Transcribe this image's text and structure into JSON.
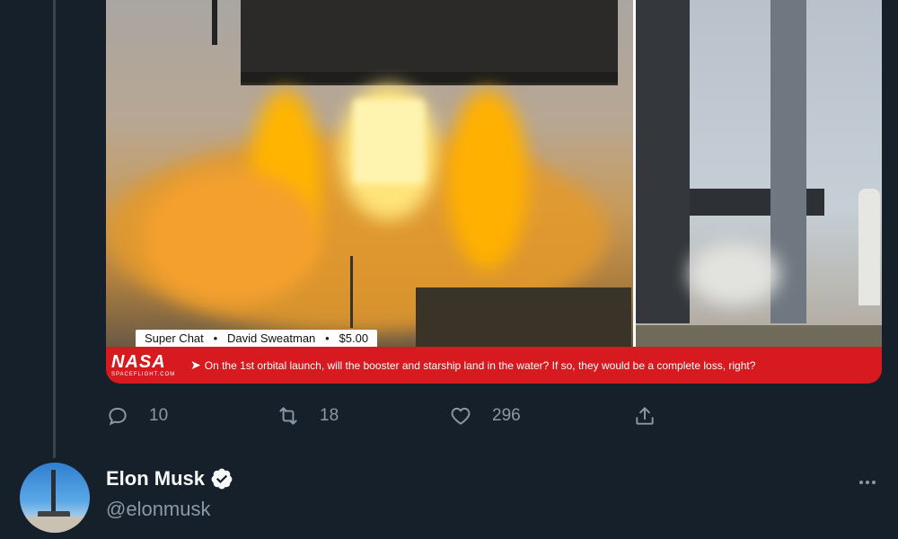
{
  "media": {
    "superchat": {
      "label": "Super Chat",
      "sep": "•",
      "name": "David Sweatman",
      "amount": "$5.00"
    },
    "banner": {
      "logo": "NASA",
      "logo_sub": "SPACEFLIGHT.COM",
      "arrow": "➤",
      "question": "On the 1st orbital launch, will the booster and starship land in the water? If so, they would be a complete loss, right?"
    }
  },
  "actions": {
    "reply_icon": "reply-icon",
    "reply_count": "10",
    "retweet_icon": "retweet-icon",
    "retweet_count": "18",
    "like_icon": "heart-icon",
    "like_count": "296",
    "share_icon": "share-icon"
  },
  "author": {
    "name": "Elon Musk",
    "handle": "@elonmusk",
    "verified": true
  },
  "colors": {
    "background": "#15202b",
    "muted": "#8b98a5",
    "banner_red": "#d71920"
  }
}
